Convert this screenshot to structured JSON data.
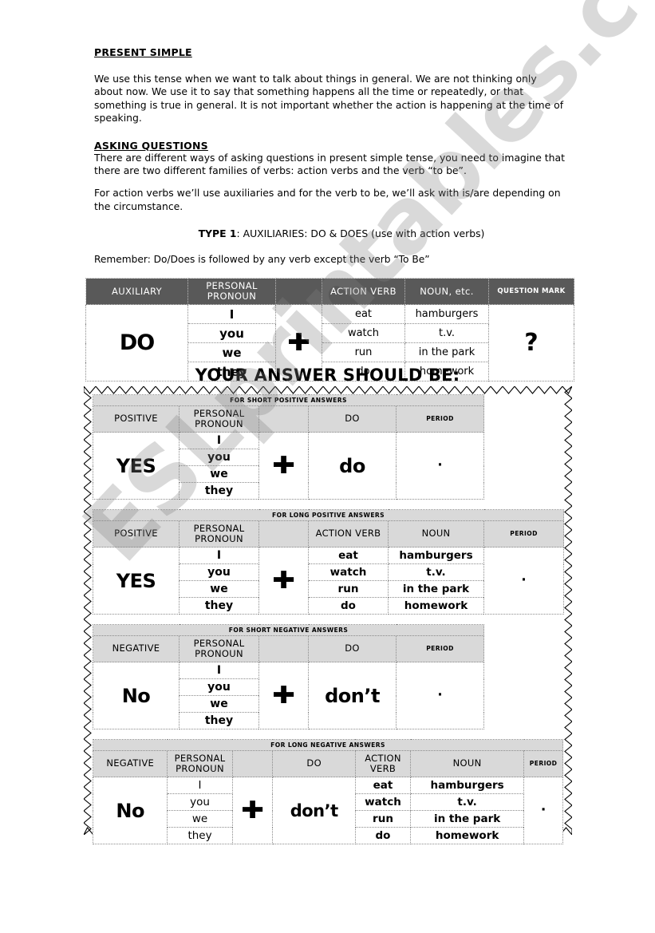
{
  "document": {
    "sections": {
      "present_simple_title": "PRESENT SIMPLE",
      "present_simple_body": "We use this tense when we want to talk about things in general. We are not thinking only about now. We use it to say that something happens all the time or repeatedly, or that something is true in general. It is not important whether the action is happening at the time of speaking.",
      "asking_questions_title": "ASKING QUESTIONS",
      "asking_questions_body": "There are different ways of asking questions in present simple tense, you need to imagine that there are two different families of verbs: action verbs and the verb “to be”.",
      "asking_questions_body2": " For action verbs we’ll use auxiliaries and for the verb to be, we’ll ask with is/are depending on the circumstance.",
      "type_label": "TYPE 1",
      "type_rest": ":  AUXILIARIES: DO & DOES  (use with action verbs)",
      "remember": "Remember: Do/Does is followed by any verb except the verb “To Be”",
      "answer_heading": "YOUR ANSWER SHOULD BE:"
    }
  },
  "question_table": {
    "headers": {
      "auxiliary": "AUXILIARY",
      "personal_pronoun": "PERSONAL\nPRONOUN",
      "personal_pronoun_l1": "PERSONAL",
      "personal_pronoun_l2": "PRONOUN",
      "blank": "",
      "action_verb": "ACTION VERB",
      "noun": "NOUN, etc.",
      "question_mark": "QUESTION MARK"
    },
    "auxiliary_value": "DO",
    "plus": "✚",
    "question_mark_value": "?",
    "pronouns": [
      "I",
      "you",
      "we",
      "they"
    ],
    "action_verbs": [
      "eat",
      "watch",
      "run",
      "do"
    ],
    "nouns": [
      "hamburgers",
      "t.v.",
      "in the park",
      "homework"
    ]
  },
  "answer_tables": [
    {
      "caption": "FOR SHORT POSITIVE ANSWERS",
      "headers": {
        "polarity": "POSITIVE",
        "pronoun_l1": "PERSONAL",
        "pronoun_l2": "PRONOUN",
        "blank": "",
        "aux": "DO",
        "period": "PERIOD"
      },
      "polarity_value": "YES",
      "plus": "✚",
      "aux_value": "do",
      "period_value": "·",
      "pronouns": [
        "I",
        "you",
        "we",
        "they"
      ]
    },
    {
      "caption": "FOR LONG POSITIVE ANSWERS",
      "headers": {
        "polarity": "POSITIVE",
        "pronoun_l1": "PERSONAL",
        "pronoun_l2": "PRONOUN",
        "blank": "",
        "action_verb": "ACTION VERB",
        "noun": "NOUN",
        "period": "PERIOD"
      },
      "polarity_value": "YES",
      "plus": "✚",
      "period_value": "·",
      "pronouns": [
        "I",
        "you",
        "we",
        "they"
      ],
      "action_verbs": [
        "eat",
        "watch",
        "run",
        "do"
      ],
      "nouns": [
        "hamburgers",
        "t.v.",
        "in the park",
        "homework"
      ]
    },
    {
      "caption": "FOR SHORT NEGATIVE ANSWERS",
      "headers": {
        "polarity": "NEGATIVE",
        "pronoun_l1": "PERSONAL",
        "pronoun_l2": "PRONOUN",
        "blank": "",
        "aux": "DO",
        "period": "PERIOD"
      },
      "polarity_value": "No",
      "plus": "✚",
      "aux_value": "don’t",
      "period_value": "·",
      "pronouns": [
        "I",
        "you",
        "we",
        "they"
      ]
    },
    {
      "caption": "FOR LONG NEGATIVE ANSWERS",
      "headers": {
        "polarity": "NEGATIVE",
        "pronoun_l1": "PERSONAL",
        "pronoun_l2": "PRONOUN",
        "blank": "",
        "aux": "DO",
        "action_verb_l1": "ACTION",
        "action_verb_l2": "VERB",
        "noun": "NOUN",
        "period": "PERIOD"
      },
      "polarity_value": "No",
      "plus": "✚",
      "aux_value": "don’t",
      "period_value": "·",
      "pronouns": [
        "I",
        "you",
        "we",
        "they"
      ],
      "action_verbs": [
        "eat",
        "watch",
        "run",
        "do"
      ],
      "nouns": [
        "hamburgers",
        "t.v.",
        "in the park",
        "homework"
      ]
    }
  ],
  "watermark": {
    "text": "ESLprintables.com"
  },
  "colors": {
    "header_dark": "#595959",
    "header_light": "#d9d9d9",
    "text": "#000000",
    "border": "#8a8a8a"
  }
}
